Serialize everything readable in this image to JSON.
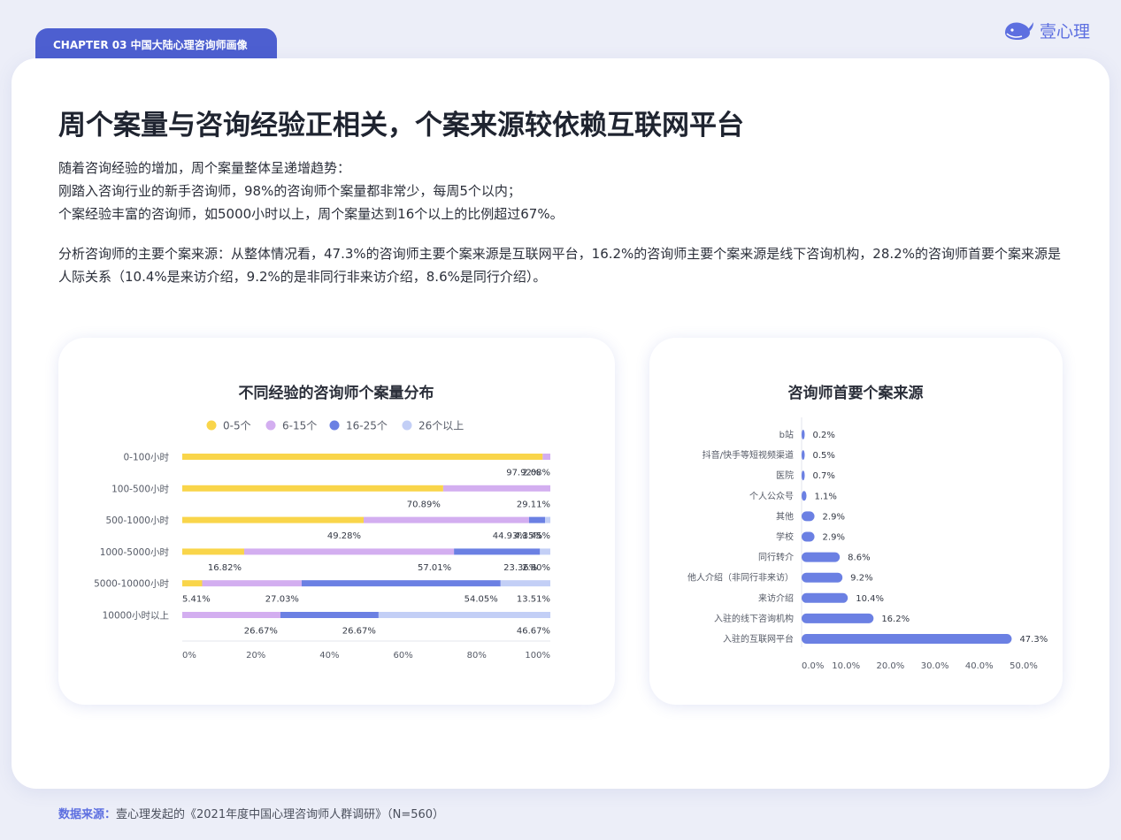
{
  "chapter": "CHAPTER 03  中国大陆心理咨询师画像",
  "brand": {
    "name": "壹心理",
    "logo_icon": "whale-icon",
    "color": "#5d6fe0"
  },
  "title": "周个案量与咨询经验正相关，个案来源较依赖互联网平台",
  "intro_lines": [
    "随着咨询经验的增加，周个案量整体呈递增趋势：",
    "刚踏入咨询行业的新手咨询师，98%的咨询师个案量都非常少，每周5个以内；",
    "个案经验丰富的咨询师，如5000小时以上，周个案量达到16个以上的比例超过67%。"
  ],
  "analysis": "分析咨询师的主要个案来源：从整体情况看，47.3%的咨询师主要个案来源是互联网平台，16.2%的咨询师主要个案来源是线下咨询机构，28.2%的咨询师首要个案来源是人际关系（10.4%是来访介绍，9.2%的是非同行非来访介绍，8.6%是同行介绍）。",
  "footer": {
    "label": "数据来源：",
    "text": "壹心理发起的《2021年度中国心理咨询师人群调研》（N=560）"
  },
  "chart_data": [
    {
      "type": "bar",
      "orientation": "horizontal",
      "stacked": true,
      "title": "不同经验的咨询师个案量分布",
      "categories": [
        "0-100小时",
        "100-500小时",
        "500-1000小时",
        "1000-5000小时",
        "5000-10000小时",
        "10000小时以上"
      ],
      "series": [
        {
          "name": "0-5个",
          "color": "#f9d54a",
          "values": [
            97.92,
            70.89,
            49.28,
            16.82,
            5.41,
            0
          ]
        },
        {
          "name": "6-15个",
          "color": "#d3aef0",
          "values": [
            2.08,
            29.11,
            44.93,
            57.01,
            27.03,
            26.67
          ]
        },
        {
          "name": "16-25个",
          "color": "#6b80e3",
          "values": [
            0,
            0,
            4.35,
            23.36,
            54.05,
            26.67
          ]
        },
        {
          "name": "26个以上",
          "color": "#c3cff6",
          "values": [
            0,
            0,
            1.45,
            2.8,
            13.51,
            46.67
          ]
        }
      ],
      "data_labels": [
        [
          "97.92%",
          "2.08%"
        ],
        [
          "70.89%",
          "29.11%"
        ],
        [
          "49.28%",
          "44.93%",
          "4.35%",
          "1.45%"
        ],
        [
          "16.82%",
          "57.01%",
          "23.36%",
          "2.80%"
        ],
        [
          "5.41%",
          "27.03%",
          "54.05%",
          "13.51%"
        ],
        [
          "26.67%",
          "26.67%",
          "46.67%"
        ]
      ],
      "x_ticks": [
        "0%",
        "20%",
        "40%",
        "60%",
        "80%",
        "100%"
      ],
      "xlim": [
        0,
        100
      ],
      "legend": "top-center"
    },
    {
      "type": "bar",
      "orientation": "horizontal",
      "title": "咨询师首要个案来源",
      "color": "#6b80e3",
      "categories": [
        "b站",
        "抖音/快手等短视频渠道",
        "医院",
        "个人公众号",
        "其他",
        "学校",
        "同行转介",
        "他人介绍（非同行非来访）",
        "来访介绍",
        "入驻的线下咨询机构",
        "入驻的互联网平台"
      ],
      "values": [
        0.2,
        0.5,
        0.7,
        1.1,
        2.9,
        2.9,
        8.6,
        9.2,
        10.4,
        16.2,
        47.3
      ],
      "value_labels": [
        "0.2%",
        "0.5%",
        "0.7%",
        "1.1%",
        "2.9%",
        "2.9%",
        "8.6%",
        "9.2%",
        "10.4%",
        "16.2%",
        "47.3%"
      ],
      "x_ticks": [
        "0.0%",
        "10.0%",
        "20.0%",
        "30.0%",
        "40.0%",
        "50.0%"
      ],
      "xlim": [
        0,
        50
      ]
    }
  ]
}
